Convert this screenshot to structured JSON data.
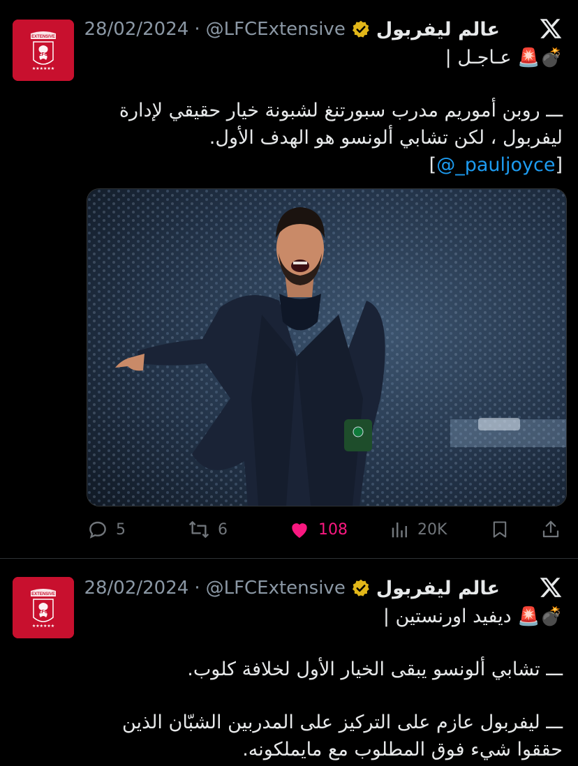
{
  "tweets": [
    {
      "author_name": "عالم ليفربول",
      "handle": "@LFCExtensive",
      "separator": "·",
      "date": "28/02/2024",
      "headline_emoji": "💣🚨",
      "headline_text": "عـاجـل |",
      "body_lines": [
        "ـــ روبن أموريم مدرب سبورتنغ لشبونة خيار حقيقي لإدارة",
        "ليفربول ، لكن تشابي ألونسو هو الهدف الأول."
      ],
      "mention": "@_pauljoyce",
      "mention_open": "[",
      "mention_close": "]",
      "stats": {
        "replies": "5",
        "reposts": "6",
        "likes": "108",
        "views": "20K"
      }
    },
    {
      "author_name": "عالم ليفربول",
      "handle": "@LFCExtensive",
      "separator": "·",
      "date": "28/02/2024",
      "headline_emoji": "💣🚨",
      "headline_text": "ديفيد اورنستين |",
      "body_lines": [
        "ـــ تشابي ألونسو يبقى الخيار الأول لخلافة كلوب.",
        "ـــ ليفربول عازم على التركيز على المدربين الشبّان الذين",
        "حققوا شيء فوق المطلوب مع مايملكونه."
      ]
    }
  ],
  "avatar_text": "EXTENSIVE",
  "avatar_letters": "LFC",
  "colors": {
    "background": "#000000",
    "text": "#e7e9ea",
    "muted": "#8b98a5",
    "link": "#1d9bf0",
    "like": "#f91880",
    "avatar_red": "#c8102e",
    "verified_gold": "#e2b719"
  },
  "icons": [
    "x-logo-icon",
    "verified-badge-icon",
    "reply-icon",
    "repost-icon",
    "like-icon",
    "views-icon",
    "bookmark-icon",
    "share-icon"
  ]
}
